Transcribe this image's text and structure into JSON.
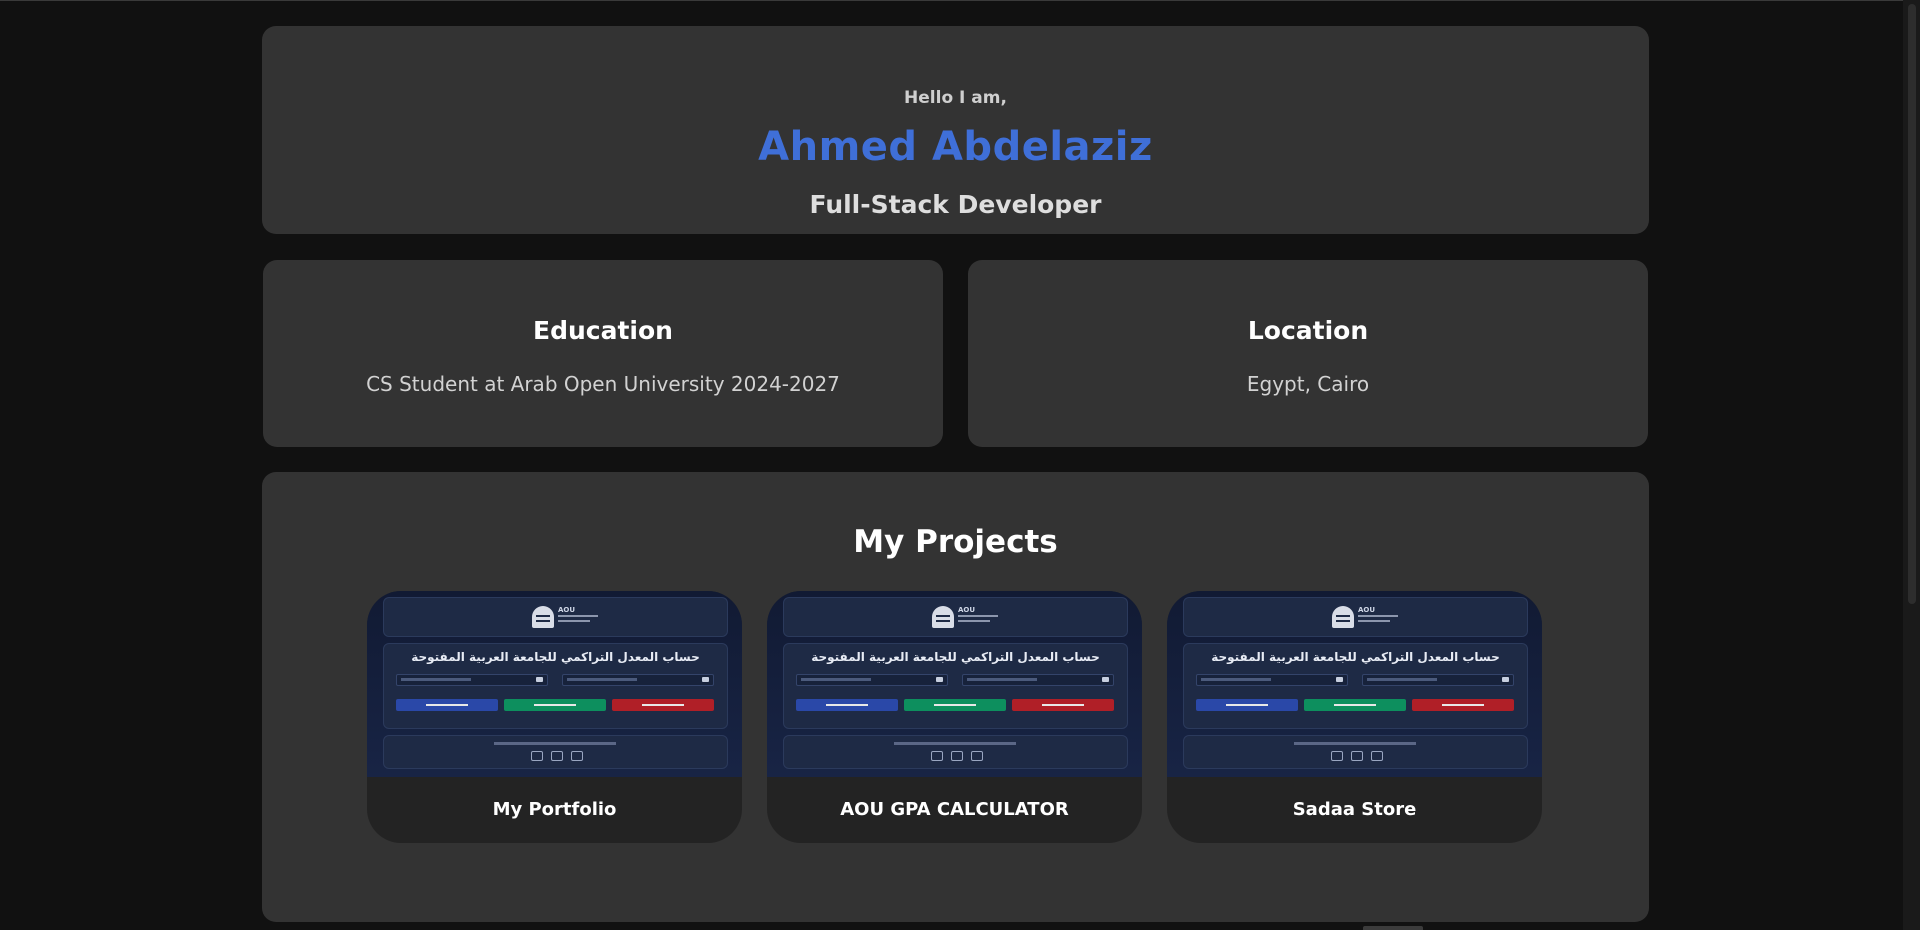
{
  "hero": {
    "greeting": "Hello I am,",
    "name": "Ahmed Abdelaziz",
    "role": "Full-Stack Developer"
  },
  "education": {
    "title": "Education",
    "text": "CS Student at Arab Open University 2024-2027"
  },
  "location": {
    "title": "Location",
    "text": "Egypt, Cairo"
  },
  "projects": {
    "title": "My Projects",
    "items": [
      {
        "name": "My Portfolio",
        "thumb_logo": "AOU",
        "thumb_heading": "حساب المعدل التراكمي للجامعة العربية المفتوحة"
      },
      {
        "name": "AOU GPA CALCULATOR",
        "thumb_logo": "AOU",
        "thumb_heading": "حساب المعدل التراكمي للجامعة العربية المفتوحة"
      },
      {
        "name": "Sadaa Store",
        "thumb_logo": "AOU",
        "thumb_heading": "حساب المعدل التراكمي للجامعة العربية المفتوحة"
      }
    ]
  },
  "colors": {
    "background": "#111111",
    "card": "#333333",
    "accent": "#3f6fd8"
  },
  "icons": [
    "github-icon",
    "linkedin-icon",
    "x-icon"
  ]
}
